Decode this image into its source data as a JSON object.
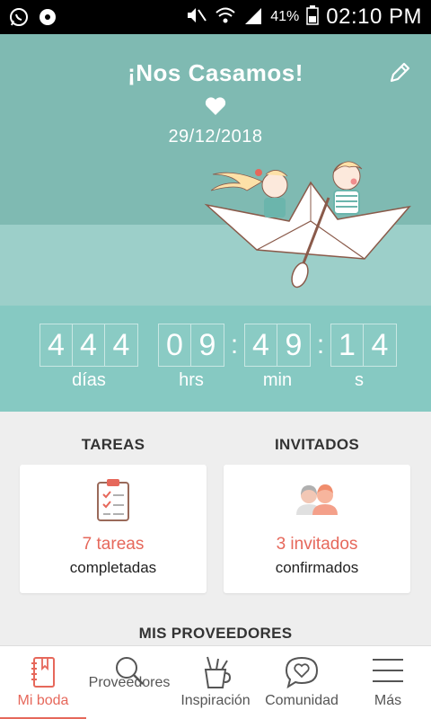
{
  "status_bar": {
    "battery": "41%",
    "time": "02:10 PM"
  },
  "hero": {
    "title": "¡Nos Casamos!",
    "date": "29/12/2018"
  },
  "countdown": {
    "days": [
      "4",
      "4",
      "4"
    ],
    "hours": [
      "0",
      "9"
    ],
    "minutes": [
      "4",
      "9"
    ],
    "seconds": [
      "1",
      "4"
    ],
    "labels": {
      "days": "días",
      "hours": "hrs",
      "minutes": "min",
      "seconds": "s"
    }
  },
  "tasks": {
    "heading": "TAREAS",
    "count": "7 tareas",
    "sub": "completadas"
  },
  "guests": {
    "heading": "INVITADOS",
    "count": "3 invitados",
    "sub": "confirmados"
  },
  "providers": {
    "heading": "MIS PROVEEDORES"
  },
  "nav": [
    {
      "label": "Mi boda",
      "active": true
    },
    {
      "label": "Proveedores"
    },
    {
      "label": "Inspiración"
    },
    {
      "label": "Comunidad"
    },
    {
      "label": "Más"
    }
  ],
  "colors": {
    "accent": "#e6685b",
    "hero": "#7fbab2",
    "countdown": "#86c9c2"
  }
}
